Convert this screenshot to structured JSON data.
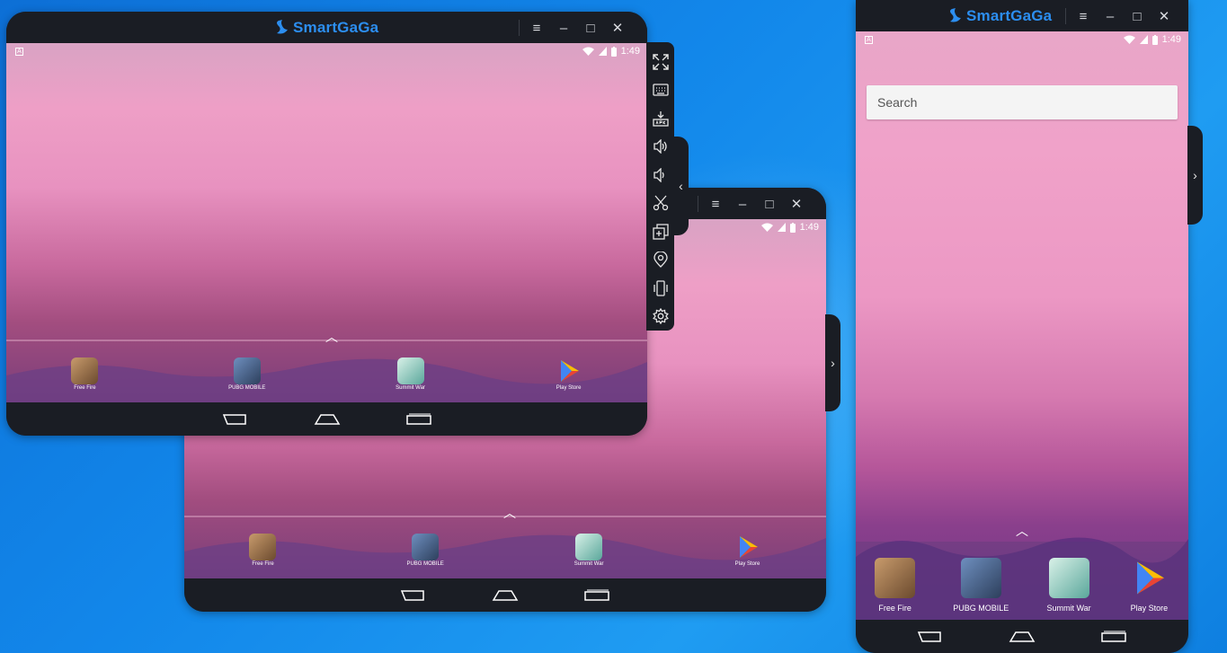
{
  "brand": "SmartGaGa",
  "status": {
    "time": "1:49",
    "notification": "A"
  },
  "dock_apps": [
    {
      "label": "Free Fire"
    },
    {
      "label": "PUBG MOBILE"
    },
    {
      "label": "Summit War"
    },
    {
      "label": "Play Store"
    }
  ],
  "search": {
    "placeholder": "Search"
  },
  "window_controls": {
    "menu": "≡",
    "minimize": "–",
    "maximize": "□",
    "close": "✕"
  },
  "colors": {
    "brand": "#2c8ef0",
    "chrome": "#1a1d24",
    "desktop": "#1287ea"
  },
  "toolbar_icons": [
    "fullscreen-icon",
    "keyboard-icon",
    "apk-install-icon",
    "volume-up-icon",
    "volume-down-icon",
    "screenshot-scissors-icon",
    "multi-instance-icon",
    "location-icon",
    "shake-icon",
    "settings-gear-icon"
  ]
}
